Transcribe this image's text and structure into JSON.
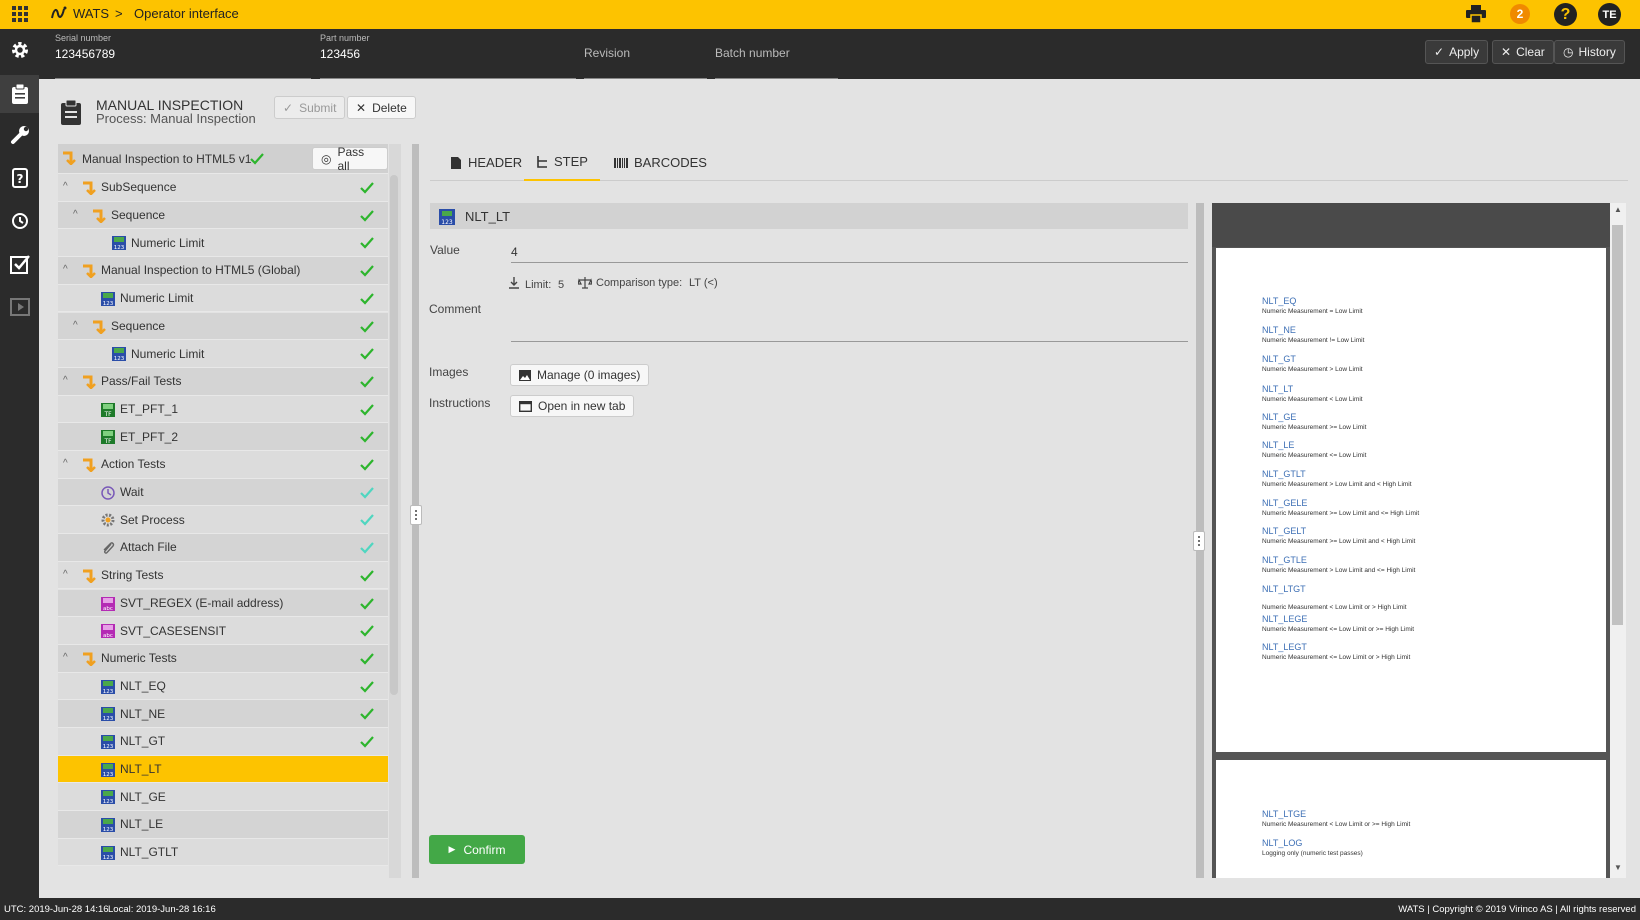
{
  "topbar": {
    "app_name": "WATS",
    "separator": ">",
    "page": "Operator interface",
    "notifications": "2",
    "help": "?",
    "user_initials": "TE"
  },
  "fields": {
    "serial_label": "Serial number",
    "serial_value": "123456789",
    "part_label": "Part number",
    "part_value": "123456",
    "revision_placeholder": "Revision",
    "batch_placeholder": "Batch number",
    "apply": "Apply",
    "clear": "Clear",
    "history": "History"
  },
  "header": {
    "title": "MANUAL INSPECTION",
    "subtitle": "Process: Manual Inspection",
    "submit": "Submit",
    "delete": "Delete"
  },
  "tree": {
    "root_label": "Manual Inspection to HTML5 v1",
    "pass_all": "Pass all",
    "rows": [
      {
        "label": "SubSequence",
        "level": 0,
        "icon": "seq",
        "expanded": true,
        "check": "green"
      },
      {
        "label": "Sequence",
        "level": 1,
        "icon": "seq",
        "expanded": true,
        "check": "green"
      },
      {
        "label": "Numeric Limit",
        "level": 2,
        "icon": "num",
        "check": "green"
      },
      {
        "label": "Manual Inspection to HTML5 (Global)",
        "level": 0,
        "icon": "seq",
        "expanded": true,
        "check": "green"
      },
      {
        "label": "Numeric Limit",
        "level": 1,
        "icon": "num",
        "check": "green"
      },
      {
        "label": "Sequence",
        "level": 1,
        "icon": "seq",
        "expanded": true,
        "check": "green"
      },
      {
        "label": "Numeric Limit",
        "level": 2,
        "icon": "num",
        "check": "green"
      },
      {
        "label": "Pass/Fail Tests",
        "level": 0,
        "icon": "seq",
        "expanded": true,
        "check": "green"
      },
      {
        "label": "ET_PFT_1",
        "level": 1,
        "icon": "pft",
        "check": "green"
      },
      {
        "label": "ET_PFT_2",
        "level": 1,
        "icon": "pft",
        "check": "green"
      },
      {
        "label": "Action Tests",
        "level": 0,
        "icon": "seq",
        "expanded": true,
        "check": "green"
      },
      {
        "label": "Wait",
        "level": 1,
        "icon": "wait",
        "check": "teal"
      },
      {
        "label": "Set Process",
        "level": 1,
        "icon": "process",
        "check": "teal"
      },
      {
        "label": "Attach File",
        "level": 1,
        "icon": "attach",
        "check": "teal"
      },
      {
        "label": "String Tests",
        "level": 0,
        "icon": "seq",
        "expanded": true,
        "check": "green"
      },
      {
        "label": "SVT_REGEX (E-mail address)",
        "level": 1,
        "icon": "str",
        "check": "green"
      },
      {
        "label": "SVT_CASESENSIT",
        "level": 1,
        "icon": "str",
        "check": "green"
      },
      {
        "label": "Numeric Tests",
        "level": 0,
        "icon": "seq",
        "expanded": true,
        "check": "green"
      },
      {
        "label": "NLT_EQ",
        "level": 1,
        "icon": "num",
        "check": "green"
      },
      {
        "label": "NLT_NE",
        "level": 1,
        "icon": "num",
        "check": "green"
      },
      {
        "label": "NLT_GT",
        "level": 1,
        "icon": "num",
        "check": "green"
      },
      {
        "label": "NLT_LT",
        "level": 1,
        "icon": "num",
        "check": "none",
        "selected": true
      },
      {
        "label": "NLT_GE",
        "level": 1,
        "icon": "num",
        "check": "none"
      },
      {
        "label": "NLT_LE",
        "level": 1,
        "icon": "num",
        "check": "none"
      },
      {
        "label": "NLT_GTLT",
        "level": 1,
        "icon": "num",
        "check": "none"
      }
    ]
  },
  "tabs": {
    "header": "HEADER",
    "step": "STEP",
    "barcodes": "BARCODES"
  },
  "step": {
    "name": "NLT_LT",
    "value_label": "Value",
    "value": "4",
    "limit_label": "Limit:",
    "limit_value": "5",
    "comparison_label": "Comparison type:",
    "comparison_value": "LT (<)",
    "comment_label": "Comment",
    "images_label": "Images",
    "manage_button": "Manage (0 images)",
    "instructions_label": "Instructions",
    "open_button": "Open in new tab",
    "confirm": "Confirm"
  },
  "preview": {
    "page1": [
      {
        "title": "NLT_EQ",
        "desc": "Numeric Measurement = Low Limit"
      },
      {
        "title": "NLT_NE",
        "desc": "Numeric Measurement != Low Limit"
      },
      {
        "title": "NLT_GT",
        "desc": "Numeric Measurement > Low Limit"
      },
      {
        "title": "NLT_LT",
        "desc": "Numeric Measurement < Low Limit"
      },
      {
        "title": "NLT_GE",
        "desc": "Numeric Measurement >= Low Limit"
      },
      {
        "title": "NLT_LE",
        "desc": "Numeric Measurement <= Low Limit"
      },
      {
        "title": "NLT_GTLT",
        "desc": "Numeric Measurement > Low Limit and < High Limit"
      },
      {
        "title": "NLT_GELE",
        "desc": "Numeric Measurement >= Low Limit and <= High Limit"
      },
      {
        "title": "NLT_GELT",
        "desc": "Numeric Measurement >= Low Limit and < High Limit"
      },
      {
        "title": "NLT_GTLE",
        "desc": "Numeric Measurement > Low Limit and <= High Limit"
      },
      {
        "title": "NLT_LTGT",
        "desc": "Numeric Measurement < Low Limit or > High Limit"
      },
      {
        "title": "NLT_LEGE",
        "desc": "Numeric Measurement <= Low Limit or >= High Limit"
      },
      {
        "title": "NLT_LEGT",
        "desc": "Numeric Measurement <= Low Limit or > High Limit"
      }
    ],
    "page2": [
      {
        "title": "NLT_LTGE",
        "desc": "Numeric Measurement < Low Limit or >= High Limit"
      },
      {
        "title": "NLT_LOG",
        "desc": "Logging only (numeric test passes)"
      }
    ]
  },
  "status": {
    "utc": "UTC: 2019-Jun-28 14:16",
    "local": "Local: 2019-Jun-28 16:16",
    "copyright": "WATS | Copyright © 2019 Virinco AS | All rights reserved"
  },
  "colors": {
    "accent": "#fdc300",
    "check_green": "#2db52d",
    "check_teal": "#4fd6c0",
    "confirm": "#43a847",
    "dark": "#2b2b2b"
  }
}
